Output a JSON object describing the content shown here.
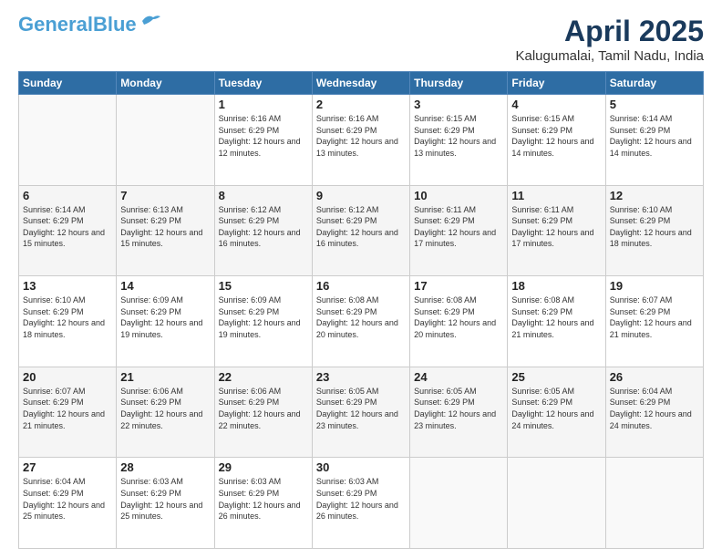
{
  "header": {
    "logo_line1": "General",
    "logo_line2": "Blue",
    "month": "April 2025",
    "location": "Kalugumalai, Tamil Nadu, India"
  },
  "weekdays": [
    "Sunday",
    "Monday",
    "Tuesday",
    "Wednesday",
    "Thursday",
    "Friday",
    "Saturday"
  ],
  "weeks": [
    [
      {
        "day": "",
        "sunrise": "",
        "sunset": "",
        "daylight": ""
      },
      {
        "day": "",
        "sunrise": "",
        "sunset": "",
        "daylight": ""
      },
      {
        "day": "1",
        "sunrise": "Sunrise: 6:16 AM",
        "sunset": "Sunset: 6:29 PM",
        "daylight": "Daylight: 12 hours and 12 minutes."
      },
      {
        "day": "2",
        "sunrise": "Sunrise: 6:16 AM",
        "sunset": "Sunset: 6:29 PM",
        "daylight": "Daylight: 12 hours and 13 minutes."
      },
      {
        "day": "3",
        "sunrise": "Sunrise: 6:15 AM",
        "sunset": "Sunset: 6:29 PM",
        "daylight": "Daylight: 12 hours and 13 minutes."
      },
      {
        "day": "4",
        "sunrise": "Sunrise: 6:15 AM",
        "sunset": "Sunset: 6:29 PM",
        "daylight": "Daylight: 12 hours and 14 minutes."
      },
      {
        "day": "5",
        "sunrise": "Sunrise: 6:14 AM",
        "sunset": "Sunset: 6:29 PM",
        "daylight": "Daylight: 12 hours and 14 minutes."
      }
    ],
    [
      {
        "day": "6",
        "sunrise": "Sunrise: 6:14 AM",
        "sunset": "Sunset: 6:29 PM",
        "daylight": "Daylight: 12 hours and 15 minutes."
      },
      {
        "day": "7",
        "sunrise": "Sunrise: 6:13 AM",
        "sunset": "Sunset: 6:29 PM",
        "daylight": "Daylight: 12 hours and 15 minutes."
      },
      {
        "day": "8",
        "sunrise": "Sunrise: 6:12 AM",
        "sunset": "Sunset: 6:29 PM",
        "daylight": "Daylight: 12 hours and 16 minutes."
      },
      {
        "day": "9",
        "sunrise": "Sunrise: 6:12 AM",
        "sunset": "Sunset: 6:29 PM",
        "daylight": "Daylight: 12 hours and 16 minutes."
      },
      {
        "day": "10",
        "sunrise": "Sunrise: 6:11 AM",
        "sunset": "Sunset: 6:29 PM",
        "daylight": "Daylight: 12 hours and 17 minutes."
      },
      {
        "day": "11",
        "sunrise": "Sunrise: 6:11 AM",
        "sunset": "Sunset: 6:29 PM",
        "daylight": "Daylight: 12 hours and 17 minutes."
      },
      {
        "day": "12",
        "sunrise": "Sunrise: 6:10 AM",
        "sunset": "Sunset: 6:29 PM",
        "daylight": "Daylight: 12 hours and 18 minutes."
      }
    ],
    [
      {
        "day": "13",
        "sunrise": "Sunrise: 6:10 AM",
        "sunset": "Sunset: 6:29 PM",
        "daylight": "Daylight: 12 hours and 18 minutes."
      },
      {
        "day": "14",
        "sunrise": "Sunrise: 6:09 AM",
        "sunset": "Sunset: 6:29 PM",
        "daylight": "Daylight: 12 hours and 19 minutes."
      },
      {
        "day": "15",
        "sunrise": "Sunrise: 6:09 AM",
        "sunset": "Sunset: 6:29 PM",
        "daylight": "Daylight: 12 hours and 19 minutes."
      },
      {
        "day": "16",
        "sunrise": "Sunrise: 6:08 AM",
        "sunset": "Sunset: 6:29 PM",
        "daylight": "Daylight: 12 hours and 20 minutes."
      },
      {
        "day": "17",
        "sunrise": "Sunrise: 6:08 AM",
        "sunset": "Sunset: 6:29 PM",
        "daylight": "Daylight: 12 hours and 20 minutes."
      },
      {
        "day": "18",
        "sunrise": "Sunrise: 6:08 AM",
        "sunset": "Sunset: 6:29 PM",
        "daylight": "Daylight: 12 hours and 21 minutes."
      },
      {
        "day": "19",
        "sunrise": "Sunrise: 6:07 AM",
        "sunset": "Sunset: 6:29 PM",
        "daylight": "Daylight: 12 hours and 21 minutes."
      }
    ],
    [
      {
        "day": "20",
        "sunrise": "Sunrise: 6:07 AM",
        "sunset": "Sunset: 6:29 PM",
        "daylight": "Daylight: 12 hours and 21 minutes."
      },
      {
        "day": "21",
        "sunrise": "Sunrise: 6:06 AM",
        "sunset": "Sunset: 6:29 PM",
        "daylight": "Daylight: 12 hours and 22 minutes."
      },
      {
        "day": "22",
        "sunrise": "Sunrise: 6:06 AM",
        "sunset": "Sunset: 6:29 PM",
        "daylight": "Daylight: 12 hours and 22 minutes."
      },
      {
        "day": "23",
        "sunrise": "Sunrise: 6:05 AM",
        "sunset": "Sunset: 6:29 PM",
        "daylight": "Daylight: 12 hours and 23 minutes."
      },
      {
        "day": "24",
        "sunrise": "Sunrise: 6:05 AM",
        "sunset": "Sunset: 6:29 PM",
        "daylight": "Daylight: 12 hours and 23 minutes."
      },
      {
        "day": "25",
        "sunrise": "Sunrise: 6:05 AM",
        "sunset": "Sunset: 6:29 PM",
        "daylight": "Daylight: 12 hours and 24 minutes."
      },
      {
        "day": "26",
        "sunrise": "Sunrise: 6:04 AM",
        "sunset": "Sunset: 6:29 PM",
        "daylight": "Daylight: 12 hours and 24 minutes."
      }
    ],
    [
      {
        "day": "27",
        "sunrise": "Sunrise: 6:04 AM",
        "sunset": "Sunset: 6:29 PM",
        "daylight": "Daylight: 12 hours and 25 minutes."
      },
      {
        "day": "28",
        "sunrise": "Sunrise: 6:03 AM",
        "sunset": "Sunset: 6:29 PM",
        "daylight": "Daylight: 12 hours and 25 minutes."
      },
      {
        "day": "29",
        "sunrise": "Sunrise: 6:03 AM",
        "sunset": "Sunset: 6:29 PM",
        "daylight": "Daylight: 12 hours and 26 minutes."
      },
      {
        "day": "30",
        "sunrise": "Sunrise: 6:03 AM",
        "sunset": "Sunset: 6:29 PM",
        "daylight": "Daylight: 12 hours and 26 minutes."
      },
      {
        "day": "",
        "sunrise": "",
        "sunset": "",
        "daylight": ""
      },
      {
        "day": "",
        "sunrise": "",
        "sunset": "",
        "daylight": ""
      },
      {
        "day": "",
        "sunrise": "",
        "sunset": "",
        "daylight": ""
      }
    ]
  ]
}
